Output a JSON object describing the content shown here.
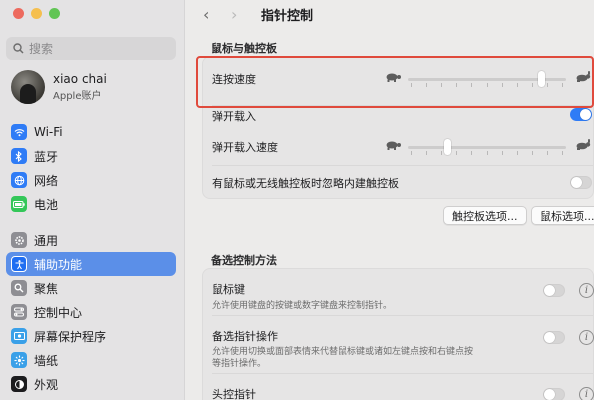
{
  "sidebar": {
    "search_placeholder": "搜索",
    "user": {
      "name": "xiao chai",
      "subtitle": "Apple账户"
    },
    "group1": [
      {
        "label": "Wi-Fi",
        "icon": "wifi-icon"
      },
      {
        "label": "蓝牙",
        "icon": "bluetooth-icon"
      },
      {
        "label": "网络",
        "icon": "globe-icon"
      },
      {
        "label": "电池",
        "icon": "battery-icon"
      }
    ],
    "group2": [
      {
        "label": "通用",
        "icon": "gear-icon"
      },
      {
        "label": "辅助功能",
        "icon": "accessibility-icon",
        "active": true
      },
      {
        "label": "聚焦",
        "icon": "magnifier-icon"
      },
      {
        "label": "控制中心",
        "icon": "control-center-icon"
      },
      {
        "label": "屏幕保护程序",
        "icon": "screensaver-icon"
      },
      {
        "label": "墙纸",
        "icon": "wallpaper-icon"
      },
      {
        "label": "外观",
        "icon": "appearance-icon"
      }
    ]
  },
  "header": {
    "title": "指针控制",
    "back": "‹",
    "forward": "›"
  },
  "section1": {
    "title": "鼠标与触控板",
    "double_click_speed": {
      "label": "连按速度",
      "level": 0.86
    },
    "spring_loading": {
      "label": "弹开载入",
      "enabled": true
    },
    "spring_loading_speed": {
      "label": "弹开载入速度",
      "level": 0.24
    },
    "ignore_trackpad": {
      "label": "有鼠标或无线触控板时忽略内建触控板",
      "enabled": false
    },
    "trackpad_options_button": "触控板选项...",
    "mouse_options_button": "鼠标选项..."
  },
  "section2": {
    "title": "备选控制方法",
    "mouse_keys": {
      "label": "鼠标键",
      "desc": "允许使用键盘的按键或数字键盘来控制指针。",
      "enabled": false
    },
    "alt_pointer": {
      "label": "备选指针操作",
      "desc_line1": "允许使用切换或面部表情来代替鼠标键或诸如左键点按和右键点按",
      "desc_line2": "等指针操作。",
      "enabled": false
    },
    "head_pointer": {
      "label": "头控指针",
      "enabled": false
    }
  },
  "colors": {
    "accent": "#2f7cf6",
    "highlight": "#e04a3c"
  }
}
